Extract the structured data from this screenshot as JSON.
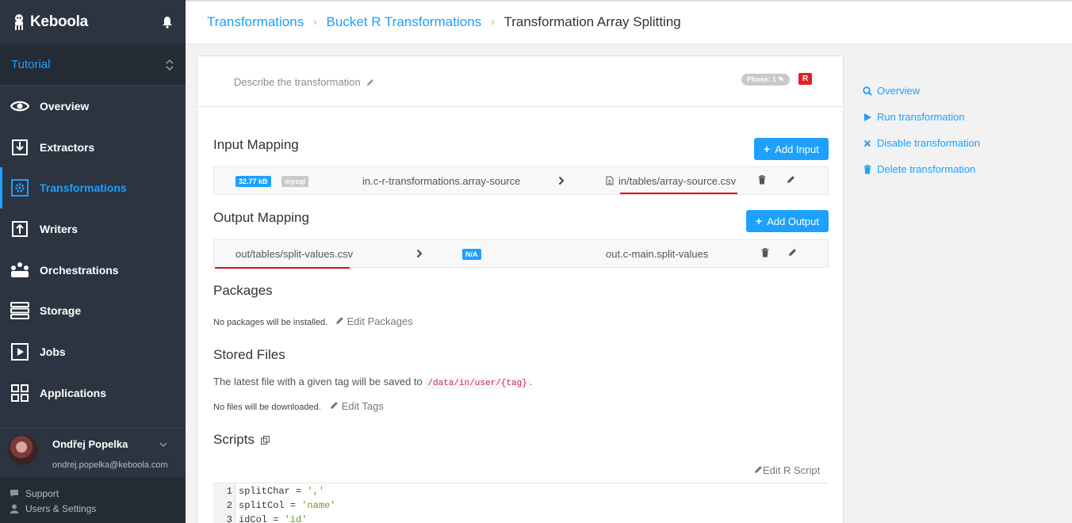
{
  "brand": {
    "name": "Keboola"
  },
  "project": {
    "name": "Tutorial"
  },
  "nav": [
    {
      "label": "Overview",
      "icon": "eye-icon"
    },
    {
      "label": "Extractors",
      "icon": "extract-icon"
    },
    {
      "label": "Transformations",
      "icon": "gear-icon",
      "active": true
    },
    {
      "label": "Writers",
      "icon": "upload-icon"
    },
    {
      "label": "Orchestrations",
      "icon": "orchestration-icon"
    },
    {
      "label": "Storage",
      "icon": "storage-icon"
    },
    {
      "label": "Jobs",
      "icon": "play-icon"
    },
    {
      "label": "Applications",
      "icon": "grid-icon"
    }
  ],
  "user": {
    "name": "Ondřej Popelka",
    "email": "ondrej.popelka@keboola.com"
  },
  "footer": {
    "support": "Support",
    "settings": "Users & Settings"
  },
  "breadcrumb": {
    "first": "Transformations",
    "second": "Bucket R Transformations",
    "current": "Transformation Array Splitting"
  },
  "header": {
    "describe": "Describe the transformation",
    "phase": "Phase: 1",
    "backend": "R"
  },
  "input_mapping": {
    "title": "Input Mapping",
    "add_label": "Add Input",
    "row": {
      "size": "32.77 kB",
      "backend": "mysql",
      "source": "in.c-r-transformations.array-source",
      "dest": "in/tables/array-source.csv"
    }
  },
  "output_mapping": {
    "title": "Output Mapping",
    "add_label": "Add Output",
    "row": {
      "source": "out/tables/split-values.csv",
      "status": "N/A",
      "dest": "out.c-main.split-values"
    }
  },
  "packages": {
    "title": "Packages",
    "note": "No packages will be installed.",
    "edit_label": "Edit Packages"
  },
  "stored_files": {
    "title": "Stored Files",
    "desc_before": "The latest file with a given tag will be saved to",
    "path": "/data/in/user/{tag}",
    "desc_after": ".",
    "note": "No files will be downloaded.",
    "edit_label": "Edit Tags"
  },
  "scripts": {
    "title": "Scripts",
    "edit_label": "Edit R Script",
    "lines": [
      {
        "num": "1",
        "var": "splitChar = ",
        "str": "','"
      },
      {
        "num": "2",
        "var": "splitCol = ",
        "str": "'name'"
      },
      {
        "num": "3",
        "var": "idCol = ",
        "str": "'id'"
      }
    ]
  },
  "actions": [
    {
      "label": "Overview",
      "icon": "search-icon"
    },
    {
      "label": "Run transformation",
      "icon": "play-icon"
    },
    {
      "label": "Disable transformation",
      "icon": "close-icon"
    },
    {
      "label": "Delete transformation",
      "icon": "trash-icon"
    }
  ],
  "colors": {
    "accent": "#1ea0ff",
    "sidebar": "#2b3440",
    "danger": "#e0202a"
  }
}
